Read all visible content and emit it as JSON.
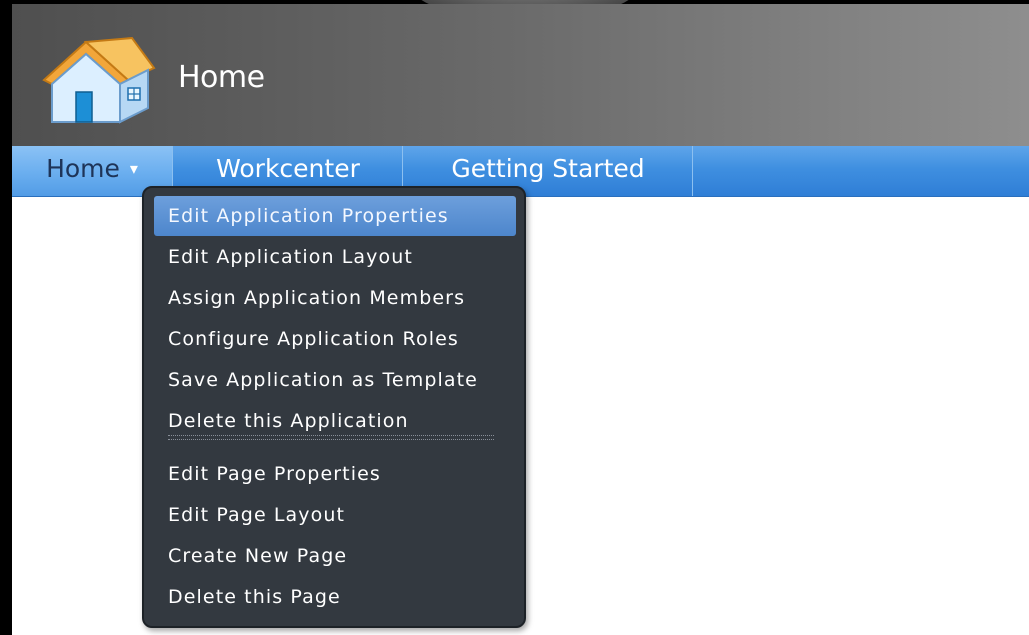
{
  "header": {
    "title": "Home",
    "logo_icon": "house-icon"
  },
  "nav": {
    "items": [
      {
        "label": "Home",
        "chevron": "▾",
        "active": true
      },
      {
        "label": "Workcenter"
      },
      {
        "label": "Getting Started"
      }
    ]
  },
  "menu": {
    "application_items": [
      {
        "label": "Edit Application Properties",
        "highlighted": true
      },
      {
        "label": "Edit Application Layout"
      },
      {
        "label": "Assign Application Members"
      },
      {
        "label": "Configure Application Roles"
      },
      {
        "label": "Save Application as Template"
      },
      {
        "label": "Delete this Application"
      }
    ],
    "page_items": [
      {
        "label": "Edit Page Properties"
      },
      {
        "label": "Edit Page Layout"
      },
      {
        "label": "Create New Page"
      },
      {
        "label": "Delete this Page"
      }
    ]
  },
  "colors": {
    "nav_bar": "#3f8fe0",
    "menu_background": "#333940",
    "menu_highlight": "#5a8fd3",
    "header_dark": "#4f4f4f",
    "header_light": "#8e8e8e"
  }
}
